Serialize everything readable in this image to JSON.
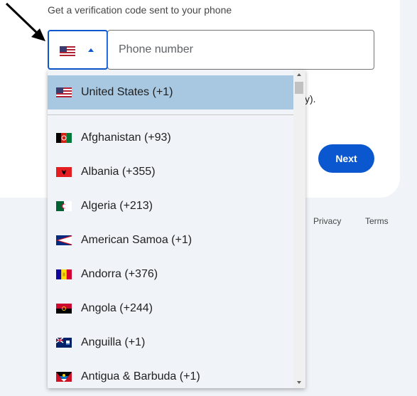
{
  "page": {
    "subtitle": "Get a verification code sent to your phone",
    "partial_text": "y).",
    "next_label": "Next",
    "footer": {
      "privacy": "Privacy",
      "terms": "Terms"
    }
  },
  "country_select": {
    "selected_flag": "us-flag-icon"
  },
  "phone_input": {
    "placeholder": "Phone number",
    "value": ""
  },
  "dropdown": {
    "selected": {
      "label": "United States (+1)",
      "flag": "us-flag-icon"
    },
    "items": [
      {
        "label": "Afghanistan (+93)",
        "flag": "afghanistan-flag-icon"
      },
      {
        "label": "Albania (+355)",
        "flag": "albania-flag-icon"
      },
      {
        "label": "Algeria (+213)",
        "flag": "algeria-flag-icon"
      },
      {
        "label": "American Samoa (+1)",
        "flag": "american-samoa-flag-icon"
      },
      {
        "label": "Andorra (+376)",
        "flag": "andorra-flag-icon"
      },
      {
        "label": "Angola (+244)",
        "flag": "angola-flag-icon"
      },
      {
        "label": "Anguilla (+1)",
        "flag": "anguilla-flag-icon"
      },
      {
        "label": "Antigua & Barbuda (+1)",
        "flag": "antigua-barbuda-flag-icon"
      }
    ]
  },
  "colors": {
    "accent": "#0b57d0",
    "selected_row": "#a8c7e1",
    "page_bg": "#f0f4f9"
  }
}
